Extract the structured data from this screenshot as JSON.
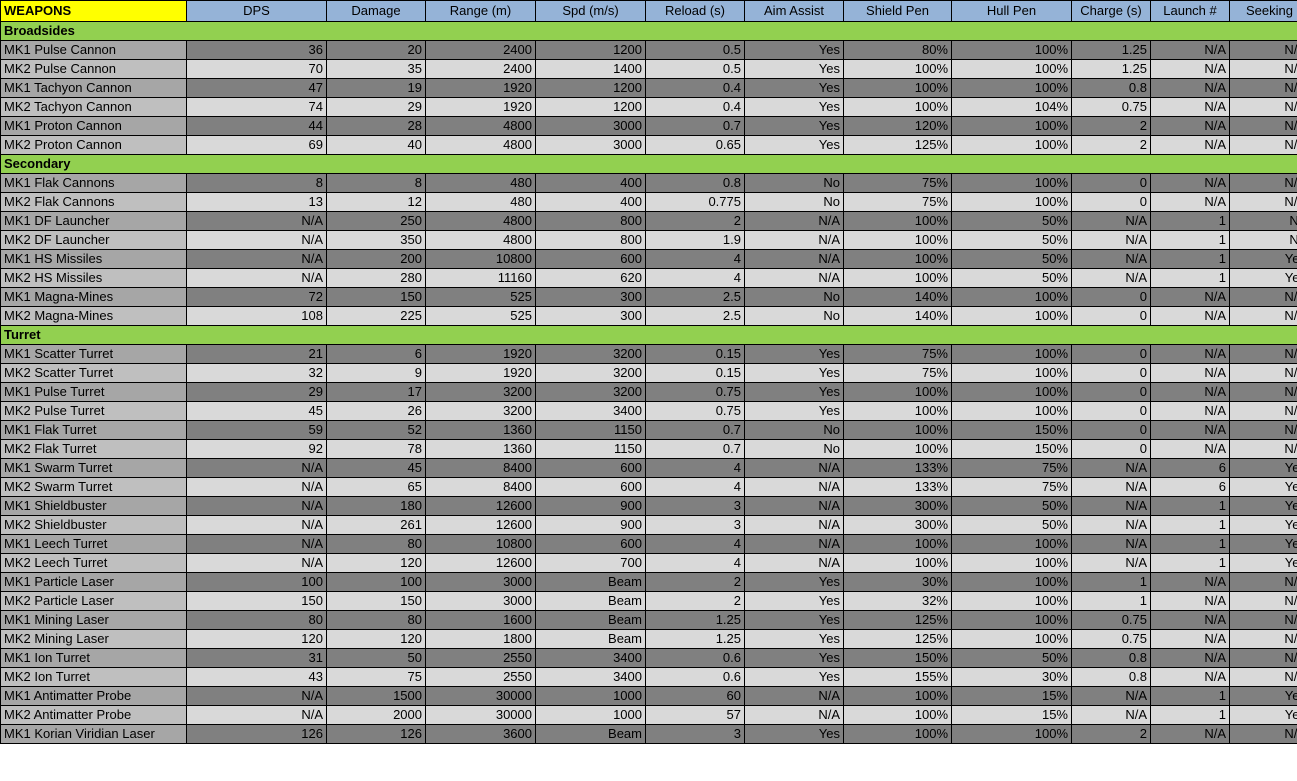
{
  "sheet": {
    "headers": [
      "WEAPONS",
      "DPS",
      "Damage",
      "Range (m)",
      "Spd (m/s)",
      "Reload (s)",
      "Aim Assist",
      "Shield Pen",
      "Hull Pen",
      "Charge (s)",
      "Launch #",
      "Seeking"
    ],
    "sections": [
      {
        "title": "Broadsides",
        "rows": [
          [
            "MK1 Pulse Cannon",
            "36",
            "20",
            "2400",
            "1200",
            "0.5",
            "Yes",
            "80%",
            "100%",
            "1.25",
            "N/A",
            "N/A"
          ],
          [
            "MK2 Pulse Cannon",
            "70",
            "35",
            "2400",
            "1400",
            "0.5",
            "Yes",
            "100%",
            "100%",
            "1.25",
            "N/A",
            "N/A"
          ],
          [
            "MK1 Tachyon Cannon",
            "47",
            "19",
            "1920",
            "1200",
            "0.4",
            "Yes",
            "100%",
            "100%",
            "0.8",
            "N/A",
            "N/A"
          ],
          [
            "MK2 Tachyon Cannon",
            "74",
            "29",
            "1920",
            "1200",
            "0.4",
            "Yes",
            "100%",
            "104%",
            "0.75",
            "N/A",
            "N/A"
          ],
          [
            "MK1 Proton Cannon",
            "44",
            "28",
            "4800",
            "3000",
            "0.7",
            "Yes",
            "120%",
            "100%",
            "2",
            "N/A",
            "N/A"
          ],
          [
            "MK2 Proton Cannon",
            "69",
            "40",
            "4800",
            "3000",
            "0.65",
            "Yes",
            "125%",
            "100%",
            "2",
            "N/A",
            "N/A"
          ]
        ]
      },
      {
        "title": "Secondary",
        "rows": [
          [
            "MK1 Flak Cannons",
            "8",
            "8",
            "480",
            "400",
            "0.8",
            "No",
            "75%",
            "100%",
            "0",
            "N/A",
            "N/A"
          ],
          [
            "MK2 Flak Cannons",
            "13",
            "12",
            "480",
            "400",
            "0.775",
            "No",
            "75%",
            "100%",
            "0",
            "N/A",
            "N/A"
          ],
          [
            "MK1 DF Launcher",
            "N/A",
            "250",
            "4800",
            "800",
            "2",
            "N/A",
            "100%",
            "50%",
            "N/A",
            "1",
            "No"
          ],
          [
            "MK2 DF Launcher",
            "N/A",
            "350",
            "4800",
            "800",
            "1.9",
            "N/A",
            "100%",
            "50%",
            "N/A",
            "1",
            "No"
          ],
          [
            "MK1 HS Missiles",
            "N/A",
            "200",
            "10800",
            "600",
            "4",
            "N/A",
            "100%",
            "50%",
            "N/A",
            "1",
            "Yes"
          ],
          [
            "MK2 HS Missiles",
            "N/A",
            "280",
            "11160",
            "620",
            "4",
            "N/A",
            "100%",
            "50%",
            "N/A",
            "1",
            "Yes"
          ],
          [
            "MK1 Magna-Mines",
            "72",
            "150",
            "525",
            "300",
            "2.5",
            "No",
            "140%",
            "100%",
            "0",
            "N/A",
            "N/A"
          ],
          [
            "MK2 Magna-Mines",
            "108",
            "225",
            "525",
            "300",
            "2.5",
            "No",
            "140%",
            "100%",
            "0",
            "N/A",
            "N/A"
          ]
        ]
      },
      {
        "title": "Turret",
        "rows": [
          [
            "MK1 Scatter Turret",
            "21",
            "6",
            "1920",
            "3200",
            "0.15",
            "Yes",
            "75%",
            "100%",
            "0",
            "N/A",
            "N/A"
          ],
          [
            "MK2 Scatter Turret",
            "32",
            "9",
            "1920",
            "3200",
            "0.15",
            "Yes",
            "75%",
            "100%",
            "0",
            "N/A",
            "N/A"
          ],
          [
            "MK1 Pulse Turret",
            "29",
            "17",
            "3200",
            "3200",
            "0.75",
            "Yes",
            "100%",
            "100%",
            "0",
            "N/A",
            "N/A"
          ],
          [
            "MK2 Pulse Turret",
            "45",
            "26",
            "3200",
            "3400",
            "0.75",
            "Yes",
            "100%",
            "100%",
            "0",
            "N/A",
            "N/A"
          ],
          [
            "MK1 Flak Turret",
            "59",
            "52",
            "1360",
            "1150",
            "0.7",
            "No",
            "100%",
            "150%",
            "0",
            "N/A",
            "N/A"
          ],
          [
            "MK2 Flak Turret",
            "92",
            "78",
            "1360",
            "1150",
            "0.7",
            "No",
            "100%",
            "150%",
            "0",
            "N/A",
            "N/A"
          ],
          [
            "MK1 Swarm Turret",
            "N/A",
            "45",
            "8400",
            "600",
            "4",
            "N/A",
            "133%",
            "75%",
            "N/A",
            "6",
            "Yes"
          ],
          [
            "MK2 Swarm Turret",
            "N/A",
            "65",
            "8400",
            "600",
            "4",
            "N/A",
            "133%",
            "75%",
            "N/A",
            "6",
            "Yes"
          ],
          [
            "MK1 Shieldbuster",
            "N/A",
            "180",
            "12600",
            "900",
            "3",
            "N/A",
            "300%",
            "50%",
            "N/A",
            "1",
            "Yes"
          ],
          [
            "MK2 Shieldbuster",
            "N/A",
            "261",
            "12600",
            "900",
            "3",
            "N/A",
            "300%",
            "50%",
            "N/A",
            "1",
            "Yes"
          ],
          [
            "MK1 Leech Turret",
            "N/A",
            "80",
            "10800",
            "600",
            "4",
            "N/A",
            "100%",
            "100%",
            "N/A",
            "1",
            "Yes"
          ],
          [
            "MK2 Leech Turret",
            "N/A",
            "120",
            "12600",
            "700",
            "4",
            "N/A",
            "100%",
            "100%",
            "N/A",
            "1",
            "Yes"
          ],
          [
            "MK1 Particle Laser",
            "100",
            "100",
            "3000",
            "Beam",
            "2",
            "Yes",
            "30%",
            "100%",
            "1",
            "N/A",
            "N/A"
          ],
          [
            "MK2 Particle Laser",
            "150",
            "150",
            "3000",
            "Beam",
            "2",
            "Yes",
            "32%",
            "100%",
            "1",
            "N/A",
            "N/A"
          ],
          [
            "MK1 Mining Laser",
            "80",
            "80",
            "1600",
            "Beam",
            "1.25",
            "Yes",
            "125%",
            "100%",
            "0.75",
            "N/A",
            "N/A"
          ],
          [
            "MK2 Mining Laser",
            "120",
            "120",
            "1800",
            "Beam",
            "1.25",
            "Yes",
            "125%",
            "100%",
            "0.75",
            "N/A",
            "N/A"
          ],
          [
            "MK1 Ion Turret",
            "31",
            "50",
            "2550",
            "3400",
            "0.6",
            "Yes",
            "150%",
            "50%",
            "0.8",
            "N/A",
            "N/A"
          ],
          [
            "MK2 Ion Turret",
            "43",
            "75",
            "2550",
            "3400",
            "0.6",
            "Yes",
            "155%",
            "30%",
            "0.8",
            "N/A",
            "N/A"
          ],
          [
            "MK1 Antimatter Probe",
            "N/A",
            "1500",
            "30000",
            "1000",
            "60",
            "N/A",
            "100%",
            "15%",
            "N/A",
            "1",
            "Yes"
          ],
          [
            "MK2 Antimatter Probe",
            "N/A",
            "2000",
            "30000",
            "1000",
            "57",
            "N/A",
            "100%",
            "15%",
            "N/A",
            "1",
            "Yes"
          ],
          [
            "MK1 Korian Viridian Laser",
            "126",
            "126",
            "3600",
            "Beam",
            "3",
            "Yes",
            "100%",
            "100%",
            "2",
            "N/A",
            "N/A"
          ]
        ]
      }
    ]
  }
}
